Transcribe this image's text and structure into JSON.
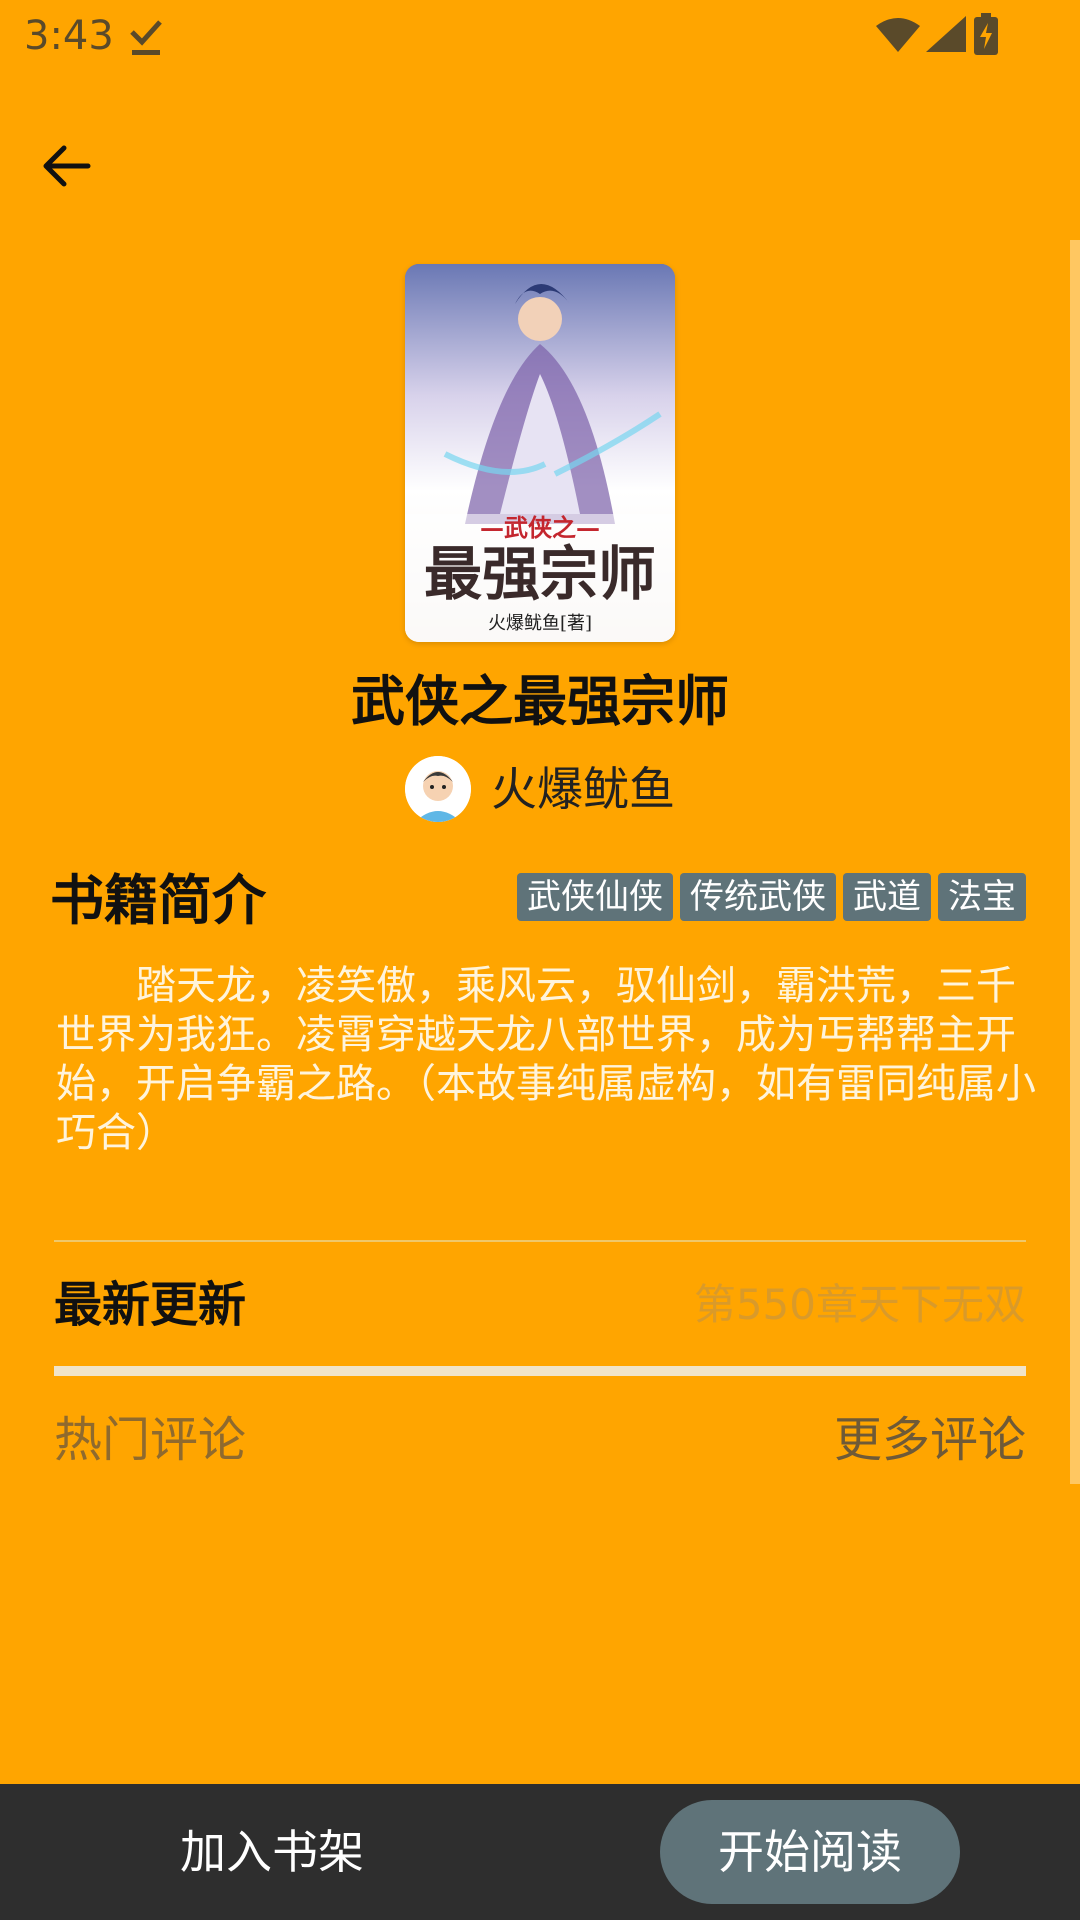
{
  "status_bar": {
    "time": "3:43",
    "icons": [
      "download-done-icon",
      "wifi-icon",
      "signal-icon",
      "battery-charging-icon"
    ]
  },
  "header": {
    "back_icon": "arrow-left-icon"
  },
  "book": {
    "cover_title_small": "—武侠之—",
    "cover_title_large": "最强宗师",
    "cover_author": "火爆鱿鱼[著]",
    "title": "武侠之最强宗师",
    "author": "火爆鱿鱼"
  },
  "intro": {
    "heading": "书籍简介",
    "tags": [
      "武侠仙侠",
      "传统武侠",
      "武道",
      "法宝"
    ],
    "text": "　　踏天龙，凌笑傲，乘风云，驭仙剑，霸洪荒，三千世界为我狂。凌霄穿越天龙八部世界，成为丐帮帮主开始，开启争霸之路。（本故事纯属虚构，如有雷同纯属小巧合）"
  },
  "latest": {
    "heading": "最新更新",
    "chapter": "第550章天下无双"
  },
  "comments": {
    "heading": "热门评论",
    "more": "更多评论"
  },
  "bottom_bar": {
    "add_to_shelf": "加入书架",
    "start_reading": "开始阅读"
  },
  "colors": {
    "background": "#FFA500",
    "tag_bg": "#5f7379",
    "bottom_bar": "#2e2e2e"
  }
}
